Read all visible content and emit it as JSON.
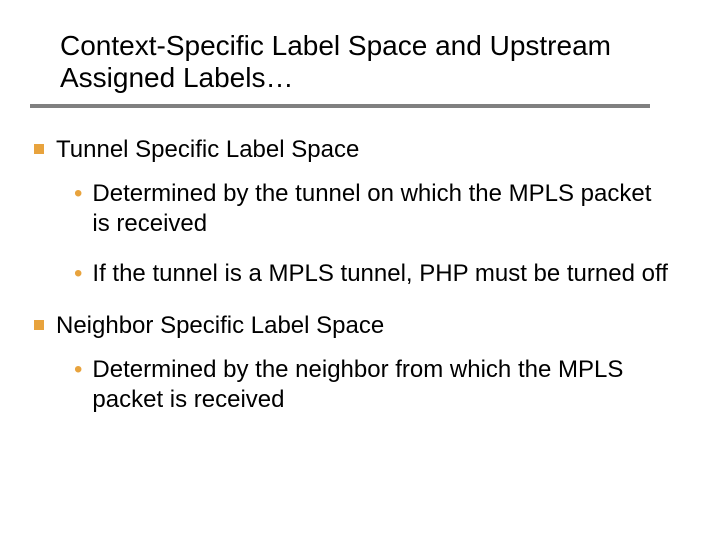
{
  "title": "Context-Specific Label Space and Upstream Assigned Labels…",
  "sections": [
    {
      "heading": "Tunnel Specific Label Space",
      "items": [
        "Determined by the tunnel on which the MPLS packet is received",
        "If the tunnel is a MPLS tunnel, PHP must be turned off"
      ]
    },
    {
      "heading": "Neighbor Specific Label Space",
      "items": [
        "Determined by the neighbor from which the MPLS packet is received"
      ]
    }
  ]
}
